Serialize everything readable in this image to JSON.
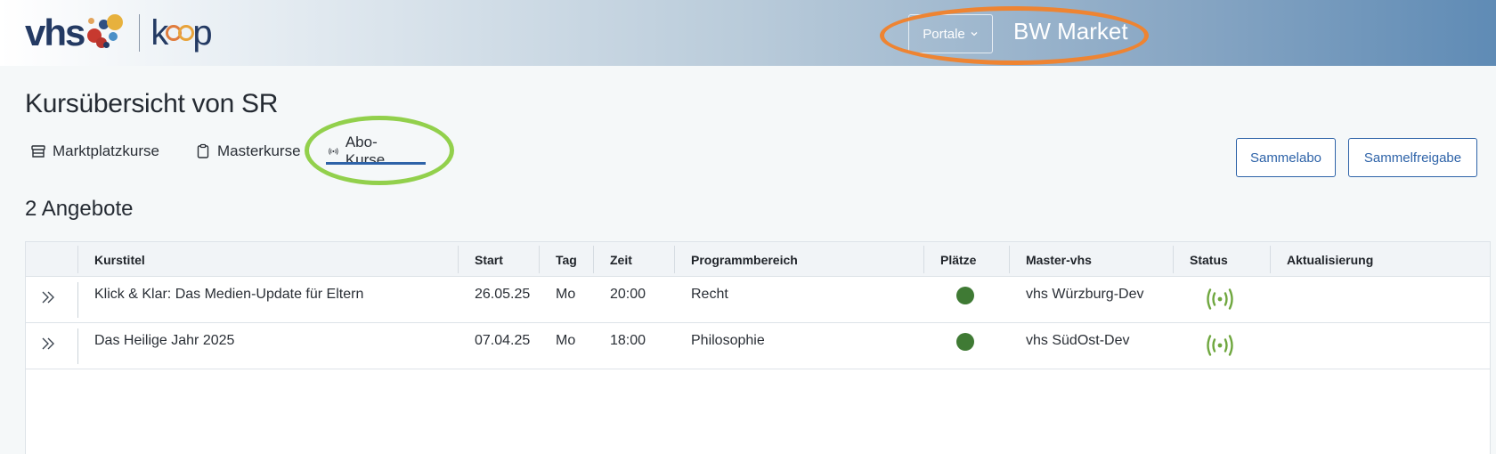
{
  "header": {
    "logo_text": "vhs",
    "logo_sub": "koop",
    "portale_label": "Portale",
    "portal_name": "BW Market"
  },
  "page": {
    "title": "Kursübersicht von SR",
    "count_label": "2 Angebote"
  },
  "tabs": [
    {
      "label": "Marktplatzkurse",
      "icon": "store-icon"
    },
    {
      "label": "Masterkurse",
      "icon": "clipboard-icon"
    },
    {
      "label": "Abo-Kurse",
      "icon": "broadcast-icon",
      "active": true
    }
  ],
  "actions": {
    "sammelabo": "Sammelabo",
    "sammelfreigabe": "Sammelfreigabe"
  },
  "table": {
    "columns": [
      "Kurstitel",
      "Start",
      "Tag",
      "Zeit",
      "Programmbereich",
      "Plätze",
      "Master-vhs",
      "Status",
      "Aktualisierung"
    ],
    "rows": [
      {
        "title": "Klick & Klar: Das Medien-Update für Eltern",
        "start": "26.05.25",
        "tag": "Mo",
        "zeit": "20:00",
        "bereich": "Recht",
        "plaetze": "available",
        "master": "vhs Würzburg-Dev",
        "status": "broadcast",
        "update": ""
      },
      {
        "title": "Das Heilige Jahr 2025",
        "start": "07.04.25",
        "tag": "Mo",
        "zeit": "18:00",
        "bereich": "Philosophie",
        "plaetze": "available",
        "master": "vhs SüdOst-Dev",
        "status": "broadcast",
        "update": ""
      }
    ]
  },
  "colors": {
    "brand_blue": "#2e63a8",
    "available_dot": "#3f7a34",
    "status_green": "#6fa73f",
    "highlight_orange": "#ee8432",
    "highlight_green": "#92d04c"
  }
}
